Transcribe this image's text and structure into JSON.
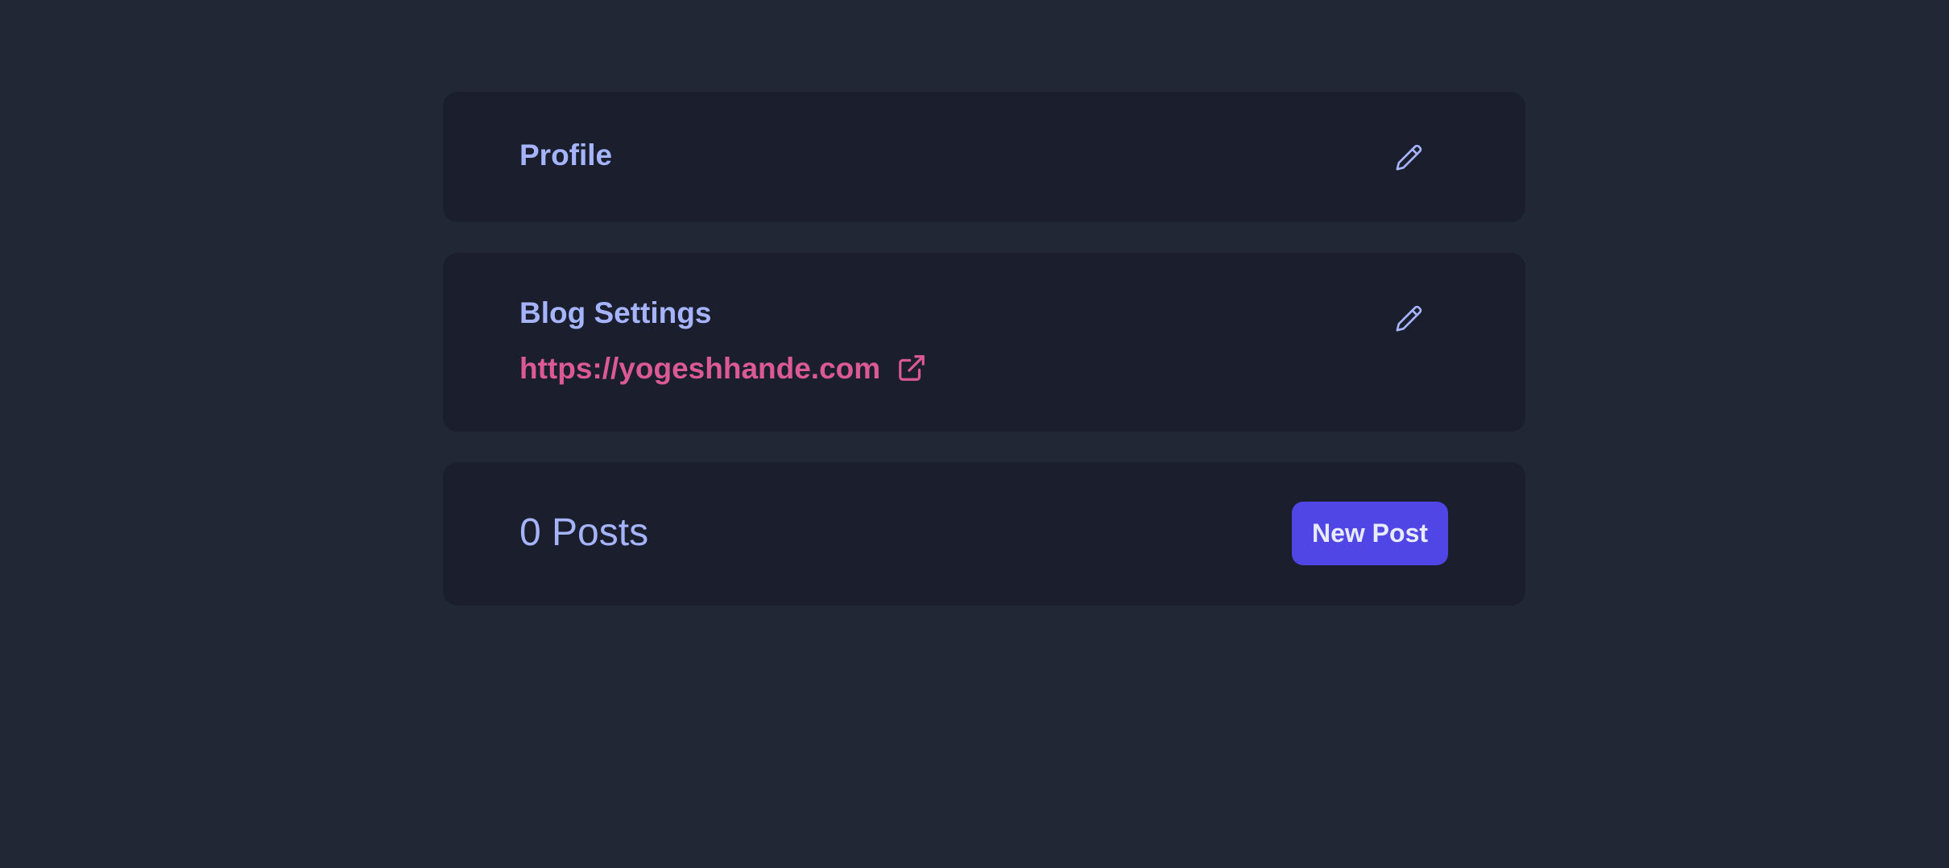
{
  "profile": {
    "title": "Profile",
    "edit_icon": "pencil-icon"
  },
  "blog_settings": {
    "title": "Blog Settings",
    "edit_icon": "pencil-icon",
    "url": "https://yogeshhande.com",
    "url_icon": "external-link-icon"
  },
  "posts": {
    "count_label": "0 Posts",
    "new_post_label": "New Post"
  },
  "colors": {
    "page_background": "#212735",
    "card_background": "#1b1f2d",
    "title_text": "#a5b4fc",
    "link_text": "#db5a93",
    "primary_button": "#4f46e5"
  }
}
